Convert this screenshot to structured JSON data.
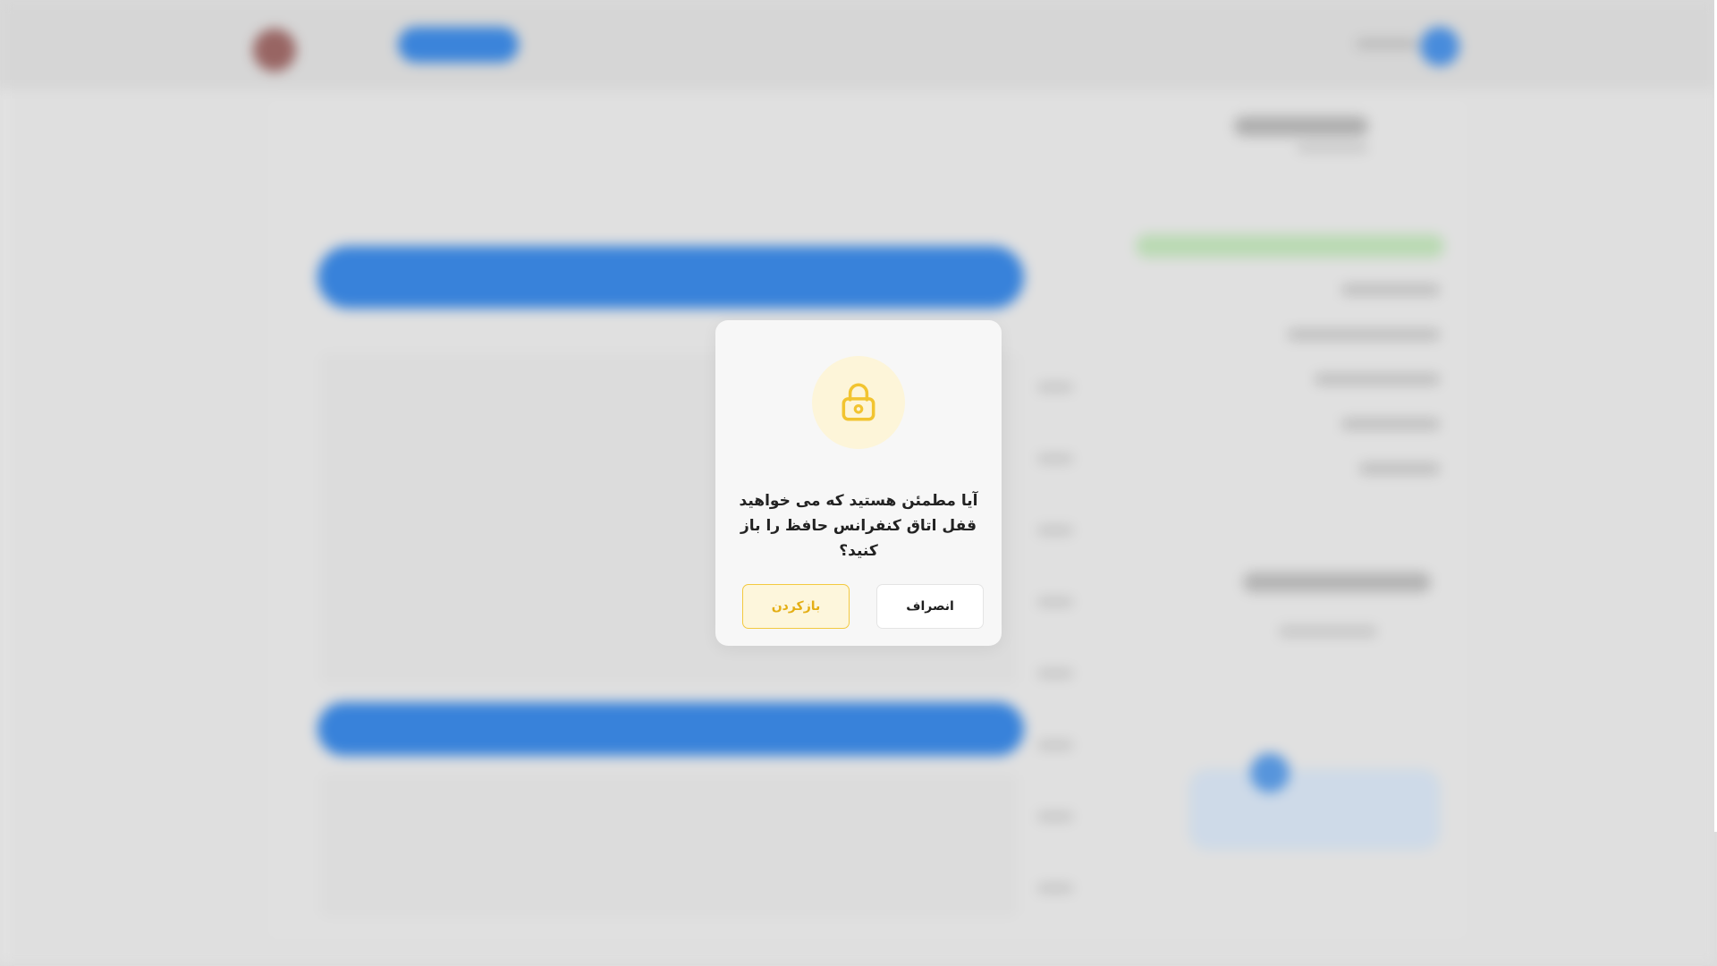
{
  "dialog": {
    "icon": "lock-icon",
    "message": "آیا مطمئن هستید که می خواهید قفل اتاق کنفرانس حافظ را باز کنید؟",
    "cancel_label": "انصراف",
    "unlock_label": "بازکردن"
  },
  "colors": {
    "accent": "#F2C430",
    "accent_soft": "#FDF5D9",
    "primary_blue": "#3A89E6",
    "success_green": "#C4E6BD"
  }
}
